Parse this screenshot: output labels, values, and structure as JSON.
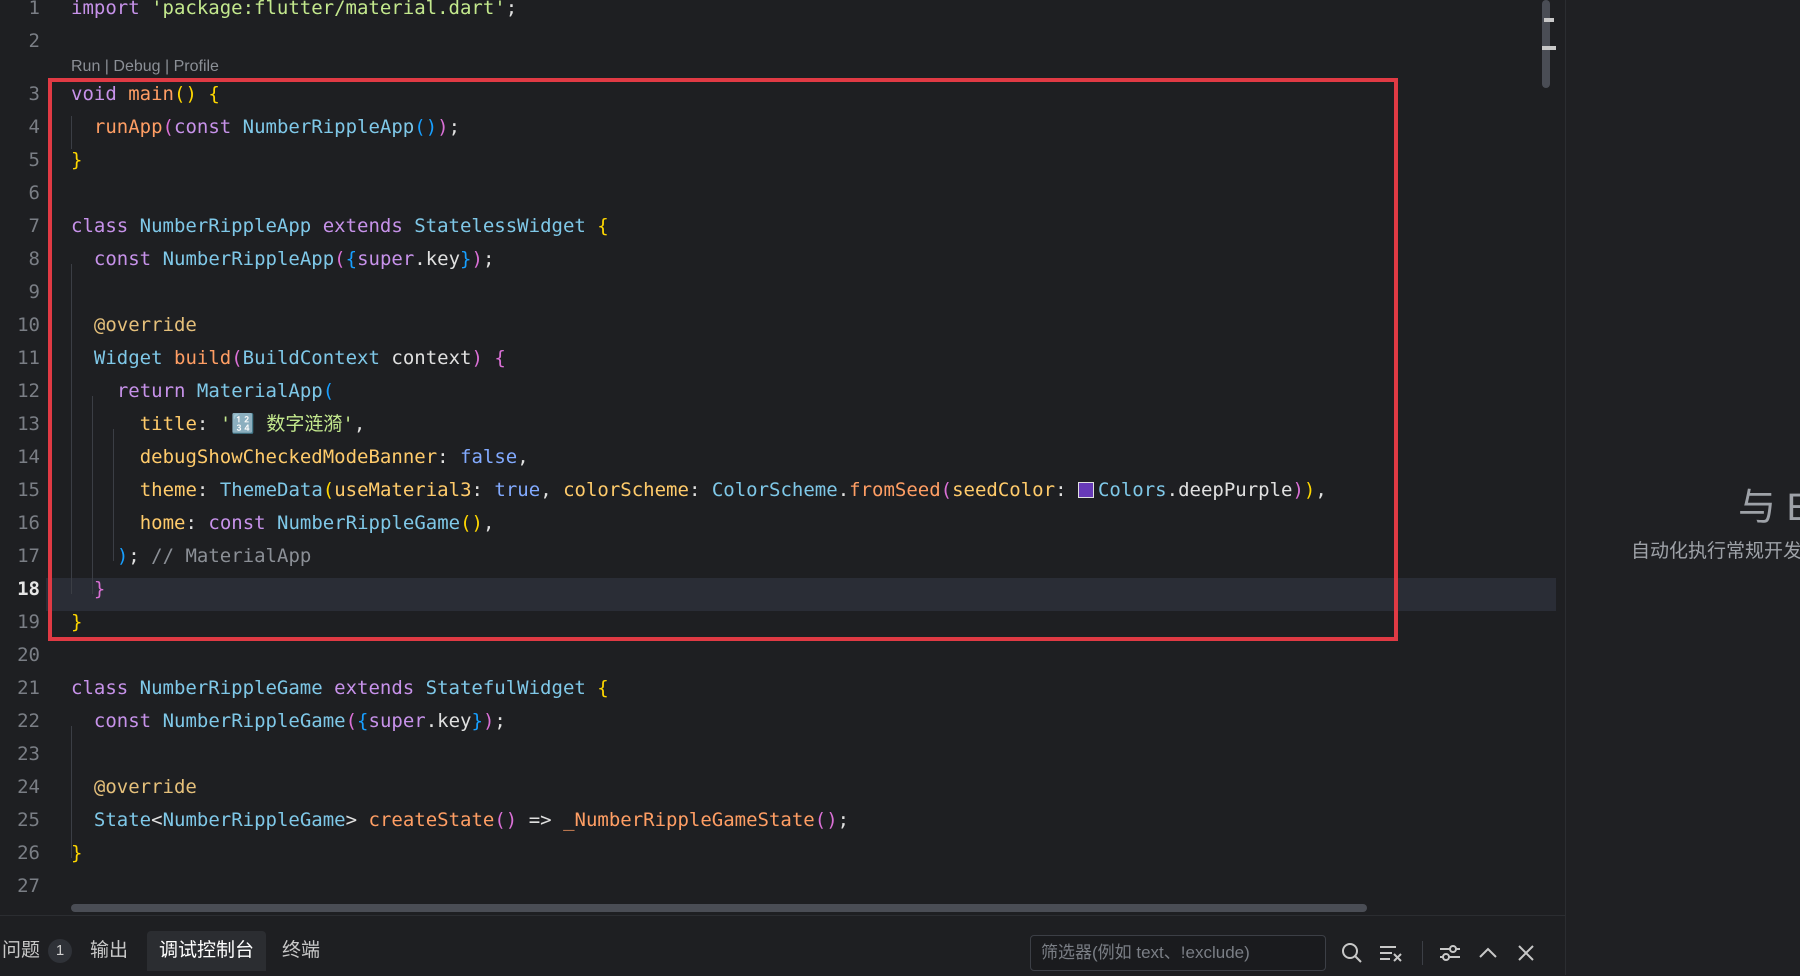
{
  "editor": {
    "codelens": "Run | Debug | Profile",
    "current_line": "18",
    "lines": [
      {
        "n": "1",
        "text": "import 'package:flutter/material.dart';"
      },
      {
        "n": "2",
        "text": ""
      },
      {
        "n": "3",
        "text": "void main() {"
      },
      {
        "n": "4",
        "text": "  runApp(const NumberRippleApp());"
      },
      {
        "n": "5",
        "text": "}"
      },
      {
        "n": "6",
        "text": ""
      },
      {
        "n": "7",
        "text": "class NumberRippleApp extends StatelessWidget {"
      },
      {
        "n": "8",
        "text": "  const NumberRippleApp({super.key});"
      },
      {
        "n": "9",
        "text": ""
      },
      {
        "n": "10",
        "text": "  @override"
      },
      {
        "n": "11",
        "text": "  Widget build(BuildContext context) {"
      },
      {
        "n": "12",
        "text": "    return MaterialApp("
      },
      {
        "n": "13",
        "text": "      title: '🔢 数字涟漪',"
      },
      {
        "n": "14",
        "text": "      debugShowCheckedModeBanner: false,"
      },
      {
        "n": "15",
        "text": "      theme: ThemeData(useMaterial3: true, colorScheme: ColorScheme.fromSeed(seedColor: Colors.deepPurple)),"
      },
      {
        "n": "16",
        "text": "      home: const NumberRippleGame(),"
      },
      {
        "n": "17",
        "text": "    ); // MaterialApp"
      },
      {
        "n": "18",
        "text": "  }"
      },
      {
        "n": "19",
        "text": "}"
      },
      {
        "n": "20",
        "text": ""
      },
      {
        "n": "21",
        "text": "class NumberRippleGame extends StatefulWidget {"
      },
      {
        "n": "22",
        "text": "  const NumberRippleGame({super.key});"
      },
      {
        "n": "23",
        "text": ""
      },
      {
        "n": "24",
        "text": "  @override"
      },
      {
        "n": "25",
        "text": "  State<NumberRippleGame> createState() => _NumberRippleGameState();"
      },
      {
        "n": "26",
        "text": "}"
      },
      {
        "n": "27",
        "text": ""
      }
    ],
    "swatch_color": "#673ab7",
    "highlight_color": "#e03a44"
  },
  "right_panel": {
    "title": "与 E",
    "subtitle": "自动化执行常规开发"
  },
  "bottom_panel": {
    "tabs": [
      {
        "label": "问题",
        "badge": "1"
      },
      {
        "label": "输出"
      },
      {
        "label": "调试控制台",
        "active": true
      },
      {
        "label": "终端"
      }
    ],
    "filter_placeholder": "筛选器(例如 text、!exclude)",
    "icons": [
      "search-icon",
      "clear-list-icon",
      "settings-icon",
      "chevron-up-icon",
      "close-icon"
    ]
  }
}
